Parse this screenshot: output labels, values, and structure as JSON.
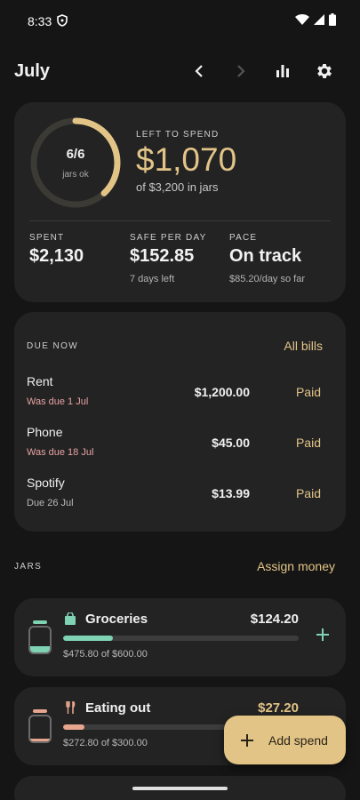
{
  "status_bar": {
    "time": "8:33"
  },
  "header": {
    "month": "July"
  },
  "summary": {
    "ring_value": "6/6",
    "ring_sub": "jars ok",
    "ring_fraction": 0.38,
    "left_label": "LEFT TO SPEND",
    "left_amount": "$1,070",
    "left_sub": "of $3,200 in jars",
    "stats": [
      {
        "label": "SPENT",
        "value": "$2,130",
        "sub": ""
      },
      {
        "label": "SAFE PER DAY",
        "value": "$152.85",
        "sub": "7 days left"
      },
      {
        "label": "PACE",
        "value": "On track",
        "sub": "$85.20/day so far"
      }
    ]
  },
  "due_now": {
    "label": "DUE NOW",
    "link": "All bills",
    "bills": [
      {
        "name": "Rent",
        "due": "Was due 1 Jul",
        "amount": "$1,200.00",
        "status": "Paid"
      },
      {
        "name": "Phone",
        "due": "Was due 18 Jul",
        "amount": "$45.00",
        "status": "Paid"
      },
      {
        "name": "Spotify",
        "due": "Due 26 Jul",
        "amount": "$13.99",
        "status": "Paid"
      }
    ]
  },
  "jars": {
    "label": "JARS",
    "link": "Assign money",
    "items": [
      {
        "name": "Groceries",
        "amount": "$124.20",
        "sub": "$475.80 of $600.00",
        "fill": 0.21,
        "color": "#7fd3b4"
      },
      {
        "name": "Eating out",
        "amount": "$27.20",
        "sub": "$272.80 of $300.00",
        "fill": 0.09,
        "color": "#e8a58e"
      }
    ]
  },
  "fab": {
    "label": "Add spend"
  },
  "colors": {
    "accent": "#e2c487",
    "overdue": "#e8a2a2",
    "background": "#151515",
    "card": "#232323"
  }
}
